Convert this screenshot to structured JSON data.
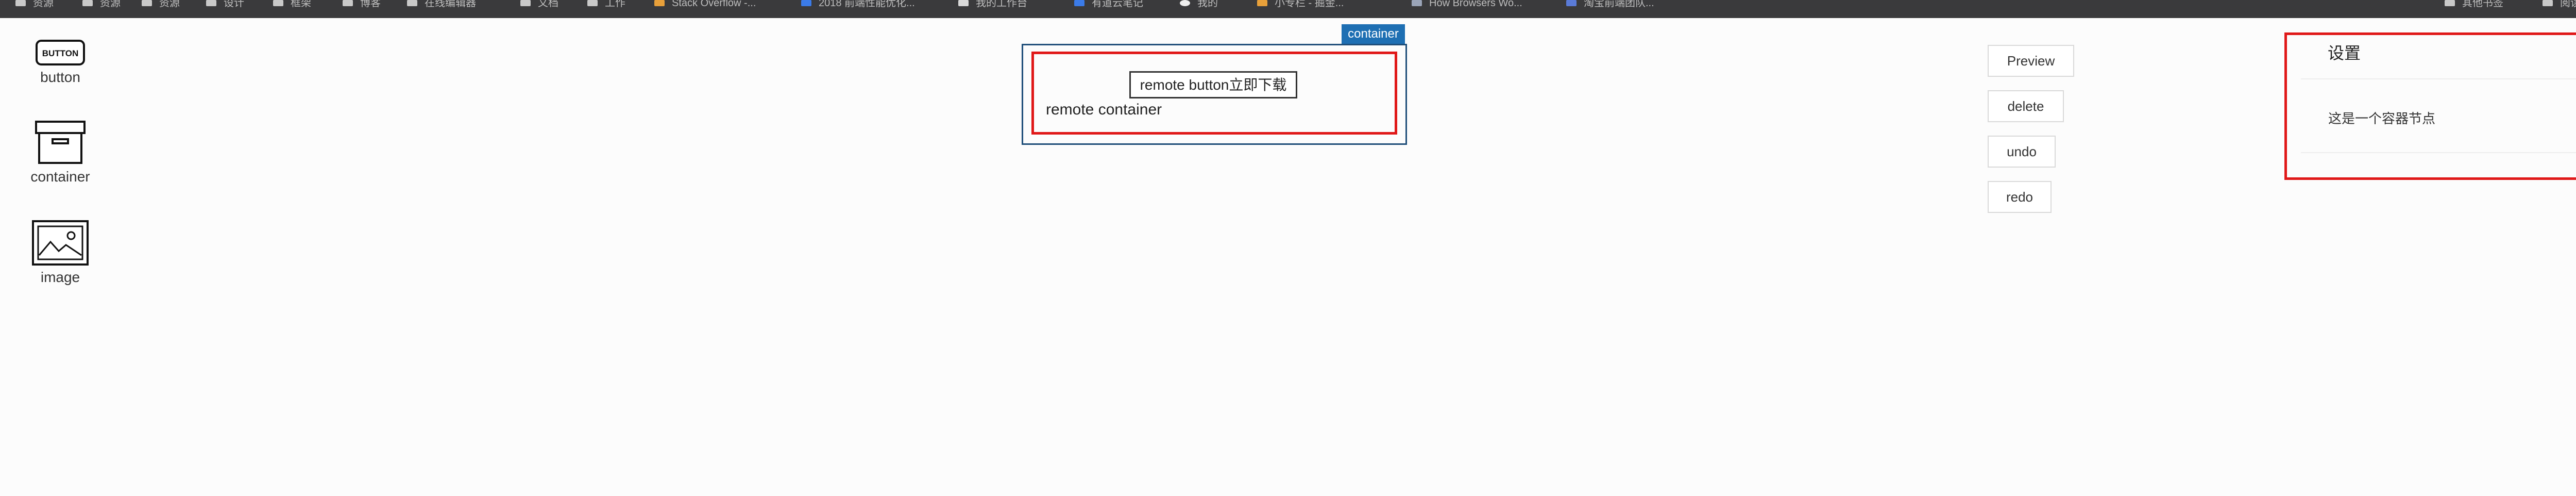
{
  "bookmarks": [
    {
      "label": "资源",
      "icon": "folder-icon"
    },
    {
      "label": "资源",
      "icon": "folder-icon"
    },
    {
      "label": "资源",
      "icon": "folder-icon"
    },
    {
      "label": "设计",
      "icon": "folder-icon"
    },
    {
      "label": "框架",
      "icon": "folder-icon"
    },
    {
      "label": "博客",
      "icon": "folder-icon"
    },
    {
      "label": "在线编辑器",
      "icon": "folder-icon"
    },
    {
      "label": "文档",
      "icon": "folder-icon"
    },
    {
      "label": "工作",
      "icon": "folder-icon"
    },
    {
      "label": "Stack Overflow -...",
      "icon": "stackoverflow-icon"
    },
    {
      "label": "2018 前端性能优化...",
      "icon": "blue-favicon-icon"
    },
    {
      "label": "我的工作台",
      "icon": "workspace-icon"
    },
    {
      "label": "有道云笔记",
      "icon": "youdao-icon"
    },
    {
      "label": "我的",
      "icon": "github-icon"
    },
    {
      "label": "小专栏 - 掘金...",
      "icon": "juejin-icon"
    },
    {
      "label": "How Browsers Wo...",
      "icon": "globe-icon"
    },
    {
      "label": "淘宝前端团队...",
      "icon": "taobao-icon"
    },
    {
      "label": "其他书签",
      "icon": "folder-icon"
    },
    {
      "label": "阅读清单",
      "icon": "folder-icon"
    }
  ],
  "palette": {
    "button": {
      "label": "button",
      "icon_text": "BUTTON"
    },
    "container": {
      "label": "container"
    },
    "image": {
      "label": "image"
    }
  },
  "canvas": {
    "selected_tag": "container",
    "remote_button": "remote button立即下载",
    "remote_container": "remote container"
  },
  "toolbar": {
    "preview": "Preview",
    "delete": "delete",
    "undo": "undo",
    "redo": "redo"
  },
  "settings": {
    "title": "设置",
    "description": "这是一个容器节点"
  },
  "colors": {
    "highlight": "#e01818",
    "selection": "#1e6fb3",
    "bookmarks_bar": "#3a3a3c"
  }
}
